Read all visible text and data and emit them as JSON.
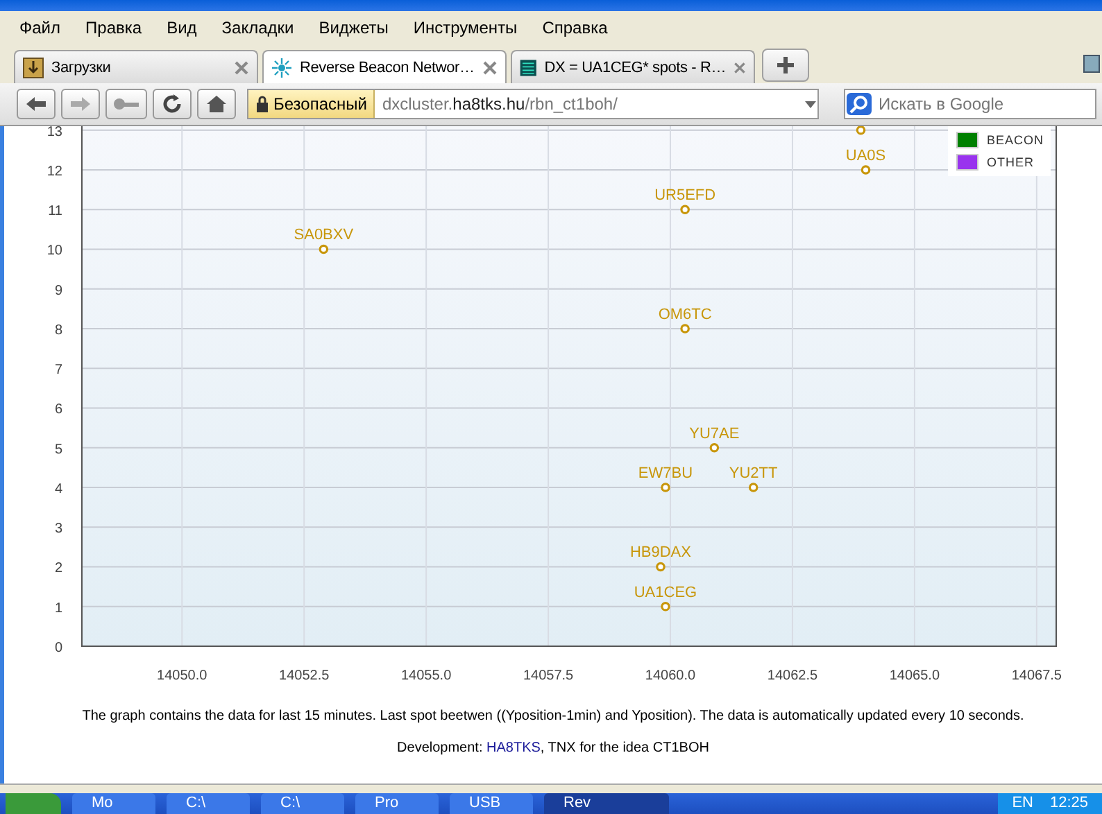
{
  "menu": [
    "Файл",
    "Правка",
    "Вид",
    "Закладки",
    "Виджеты",
    "Инструменты",
    "Справка"
  ],
  "tabs": [
    {
      "label": "Загрузки",
      "kind": "downloads",
      "selected": false
    },
    {
      "label": "Reverse Beacon Networ…",
      "kind": "beacon",
      "selected": true
    },
    {
      "label": "DX = UA1CEG* spots - R…",
      "kind": "table",
      "selected": false
    }
  ],
  "address": {
    "security": "Безопасный",
    "url": "dxcluster.**ha8tks.hu**/rbn_ct1boh/"
  },
  "search": {
    "placeholder": "Искать в Google"
  },
  "legend": [
    {
      "label": "BEACON",
      "color": "#008000"
    },
    {
      "label": "OTHER",
      "color": "#9933ee"
    }
  ],
  "chart_data": {
    "type": "scatter",
    "xlim": [
      14047.95,
      14067.9
    ],
    "ylim": [
      0,
      13.1
    ],
    "xticks": [
      {
        "value": 14050,
        "label": "14050.0"
      },
      {
        "value": 14052.5,
        "label": "14052.5"
      },
      {
        "value": 14055,
        "label": "14055.0"
      },
      {
        "value": 14057.5,
        "label": "14057.5"
      },
      {
        "value": 14060,
        "label": "14060.0"
      },
      {
        "value": 14062.5,
        "label": "14062.5"
      },
      {
        "value": 14065,
        "label": "14065.0"
      },
      {
        "value": 14067.5,
        "label": "14067.5"
      }
    ],
    "yticks": [
      0,
      1,
      2,
      3,
      4,
      5,
      6,
      7,
      8,
      9,
      10,
      11,
      12,
      13
    ],
    "x": [
      14052.9,
      14060.3,
      14063.9,
      14064.0,
      14060.3,
      14060.9,
      14059.9,
      14061.7,
      14059.8,
      14059.9
    ],
    "grid": true,
    "series": [
      {
        "color": "#c8960a",
        "values": [
          10,
          11,
          13,
          12,
          8,
          5,
          4,
          4,
          2,
          1
        ]
      }
    ],
    "value_labels": [
      "SA0BXV",
      "UR5EFD",
      null,
      "UA0S",
      "OM6TC",
      "YU7AE",
      "EW7BU",
      "YU2TT",
      "HB9DAX",
      "UA1CEG"
    ]
  },
  "note": "The graph contains the data for last 15 minutes. Last spot beetwen ((Yposition-1min) and Yposition). The data is automatically updated every 10 seconds.",
  "credit": {
    "prefix": "Development: ",
    "link": "HA8TKS",
    "suffix": ", TNX for the idea CT1BOH"
  },
  "taskbar": {
    "items": [
      {
        "label": "Mo",
        "selected": false
      },
      {
        "label": "C:\\",
        "selected": false
      },
      {
        "label": "C:\\",
        "selected": false
      },
      {
        "label": "Pro",
        "selected": false
      },
      {
        "label": "USB",
        "selected": false
      },
      {
        "label": "Rev",
        "selected": true
      }
    ],
    "language": "EN",
    "clock": "12:25"
  }
}
